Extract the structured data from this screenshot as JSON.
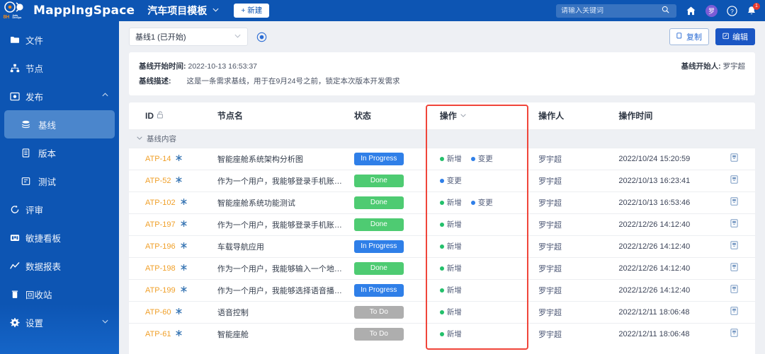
{
  "topbar": {
    "logo_name": "8h-auto-devops-logo",
    "logo_text": "8H",
    "logo_sub1": "Auto",
    "logo_sub2": "DevOps",
    "brand": "MappIngSpace",
    "project_name": "汽车项目模板",
    "project_chevron": "chevron-down-icon",
    "new_button": "+ 新建",
    "search_placeholder": "请输入关键词",
    "search_value": "",
    "home_icon": "home-icon",
    "avatar_text": "罗",
    "help_icon": "question-circle-icon",
    "bell_icon": "bell-icon",
    "bell_badge": "1"
  },
  "sidebar": {
    "items": [
      {
        "label": "文件",
        "icon": "folder-icon",
        "type": "item"
      },
      {
        "label": "节点",
        "icon": "sitemap-icon",
        "type": "item"
      },
      {
        "label": "发布",
        "icon": "publish-icon",
        "type": "item",
        "arrow": "chevron-up-icon"
      },
      {
        "label": "基线",
        "icon": "layers-icon",
        "type": "sub",
        "active": true
      },
      {
        "label": "版本",
        "icon": "version-icon",
        "type": "sub",
        "active": false
      },
      {
        "label": "测试",
        "icon": "test-icon",
        "type": "sub",
        "active": false
      },
      {
        "label": "评审",
        "icon": "review-icon",
        "type": "item"
      },
      {
        "label": "敏捷看板",
        "icon": "kanban-icon",
        "type": "item"
      },
      {
        "label": "数据报表",
        "icon": "chart-icon",
        "type": "item"
      },
      {
        "label": "回收站",
        "icon": "trash-icon",
        "type": "item"
      },
      {
        "label": "设置",
        "icon": "gear-icon",
        "type": "item",
        "arrow": "chevron-down-icon"
      }
    ]
  },
  "controls": {
    "baseline_select_value": "基线1 (已开始)",
    "select_chevron": "chevron-down-icon",
    "radio_icon": "radio-selected-icon",
    "copy_button": "复制",
    "copy_icon": "copy-icon",
    "edit_button": "编辑",
    "edit_icon": "edit-icon"
  },
  "info": {
    "start_time_label": "基线开始时间:",
    "start_time_value": "2022-10-13 16:53:37",
    "starter_label": "基线开始人:",
    "starter_value": "罗宇超",
    "desc_label": "基线描述:",
    "desc_value": "这是一条需求基线，用于在9月24号之前，锁定本次版本开发需求"
  },
  "table": {
    "headers": {
      "id": "ID",
      "id_icon": "unlock-icon",
      "name": "节点名",
      "status": "状态",
      "action": "操作",
      "action_icon": "chevron-down-icon",
      "operator": "操作人",
      "time": "操作时间"
    },
    "group_row": {
      "label": "基线内容",
      "icon": "chevron-down-icon"
    },
    "status_colors": {
      "In Progress": "#2f7fe8",
      "Done": "#4ecb72",
      "To Do": "#aeaeae"
    },
    "action_colors": {
      "新增": "#23c06b",
      "变更": "#2f7fe8"
    },
    "row_icon": "document-icon",
    "star_icon": "star-icon",
    "rows": [
      {
        "id": "ATP-14",
        "name": "智能座舱系统架构分析图",
        "status": "In Progress",
        "actions": [
          "新增",
          "变更"
        ],
        "operator": "罗宇超",
        "time": "2022/10/24 15:20:59"
      },
      {
        "id": "ATP-52",
        "name": "作为一个用户，我能够登录手机账…",
        "status": "Done",
        "actions": [
          "变更"
        ],
        "operator": "罗宇超",
        "time": "2022/10/13 16:23:41"
      },
      {
        "id": "ATP-102",
        "name": "智能座舱系统功能测试",
        "status": "Done",
        "actions": [
          "新增",
          "变更"
        ],
        "operator": "罗宇超",
        "time": "2022/10/13 16:53:46"
      },
      {
        "id": "ATP-197",
        "name": "作为一个用户，我能够登录手机账…",
        "status": "Done",
        "actions": [
          "新增"
        ],
        "operator": "罗宇超",
        "time": "2022/12/26 14:12:40"
      },
      {
        "id": "ATP-196",
        "name": "车载导航应用",
        "status": "In Progress",
        "actions": [
          "新增"
        ],
        "operator": "罗宇超",
        "time": "2022/12/26 14:12:40"
      },
      {
        "id": "ATP-198",
        "name": "作为一个用户，我能够输入一个地…",
        "status": "Done",
        "actions": [
          "新增"
        ],
        "operator": "罗宇超",
        "time": "2022/12/26 14:12:40"
      },
      {
        "id": "ATP-199",
        "name": "作为一个用户，我能够选择语音播…",
        "status": "In Progress",
        "actions": [
          "新增"
        ],
        "operator": "罗宇超",
        "time": "2022/12/26 14:12:40"
      },
      {
        "id": "ATP-60",
        "name": "语音控制",
        "status": "To Do",
        "actions": [
          "新增"
        ],
        "operator": "罗宇超",
        "time": "2022/12/11 18:06:48"
      },
      {
        "id": "ATP-61",
        "name": "智能座舱",
        "status": "To Do",
        "actions": [
          "新增"
        ],
        "operator": "罗宇超",
        "time": "2022/12/11 18:06:48"
      }
    ]
  },
  "highlight": {
    "name": "action-column-highlight",
    "color": "#f0453a"
  }
}
